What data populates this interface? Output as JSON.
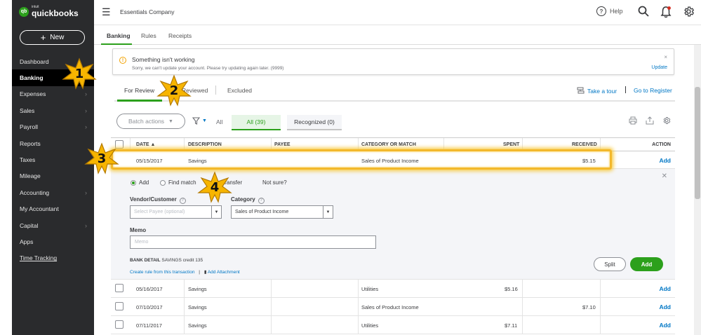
{
  "app": {
    "brand_small": "intuit",
    "brand": "quickbooks",
    "brand_mark": "qb"
  },
  "sidebar": {
    "new_label": "New",
    "items": [
      {
        "label": "Dashboard",
        "chevron": false
      },
      {
        "label": "Banking",
        "chevron": false,
        "active": true
      },
      {
        "label": "Expenses",
        "chevron": true
      },
      {
        "label": "Sales",
        "chevron": true
      },
      {
        "label": "Payroll",
        "chevron": true
      },
      {
        "label": "Reports",
        "chevron": false
      },
      {
        "label": "Taxes",
        "chevron": false
      },
      {
        "label": "Mileage",
        "chevron": false
      },
      {
        "label": "Accounting",
        "chevron": true
      },
      {
        "label": "My Accountant",
        "chevron": false
      },
      {
        "label": "Capital",
        "chevron": true
      },
      {
        "label": "Apps",
        "chevron": false
      },
      {
        "label": "Time Tracking",
        "chevron": false
      }
    ]
  },
  "topbar": {
    "company": "Essentials Company",
    "help": "Help"
  },
  "subtabs": [
    "Banking",
    "Rules",
    "Receipts"
  ],
  "alert": {
    "title": "Something isn't working",
    "message": "Sorry, we can't update your account. Please try updating again later. (9999)",
    "close": "×",
    "update": "Update"
  },
  "review_tabs": {
    "for_review": "For Review",
    "reviewed": "Reviewed",
    "excluded": "Excluded",
    "take_tour": "Take a tour",
    "go_to_register": "Go to Register"
  },
  "toolbar": {
    "batch_actions": "Batch actions",
    "all": "All",
    "all_count": "All (39)",
    "recognized": "Recognized (0)"
  },
  "table": {
    "headers": {
      "date": "DATE ▲",
      "description": "DESCRIPTION",
      "payee": "PAYEE",
      "category": "CATEGORY OR MATCH",
      "spent": "SPENT",
      "received": "RECEIVED",
      "action": "ACTION"
    },
    "highlighted_row": {
      "date": "05/15/2017",
      "description": "Savings",
      "category": "Sales of Product Income",
      "spent": "",
      "received": "$5.15",
      "action": "Add"
    },
    "rows": [
      {
        "date": "05/16/2017",
        "description": "Savings",
        "category": "Utilities",
        "spent": "$5.16",
        "received": "",
        "action": "Add"
      },
      {
        "date": "07/10/2017",
        "description": "Savings",
        "category": "Sales of Product Income",
        "spent": "",
        "received": "$7.10",
        "action": "Add"
      },
      {
        "date": "07/11/2017",
        "description": "Savings",
        "category": "Utilities",
        "spent": "$7.11",
        "received": "",
        "action": "Add"
      }
    ]
  },
  "expanded": {
    "radio_add": "Add",
    "radio_find": "Find match",
    "radio_transfer": "transfer",
    "not_sure": "Not sure?",
    "vendor_label": "Vendor/Customer",
    "vendor_placeholder": "Select Payee (optional)",
    "category_label": "Category",
    "category_value": "Sales of Product Income",
    "memo_label": "Memo",
    "memo_placeholder": "Memo",
    "bank_detail_label": "BANK DETAIL",
    "bank_detail_value": "SAVINGS credit 135",
    "create_rule": "Create rule from this transaction",
    "add_attachment": "Add Attachment",
    "split": "Split",
    "add": "Add"
  },
  "callouts": [
    "1",
    "2",
    "3",
    "4"
  ],
  "colors": {
    "sidebar": "#2a2b2d",
    "accent_green": "#2ca01c",
    "link_blue": "#0077c5",
    "callout_star": "#f7b500",
    "highlight": "#f3b82b"
  }
}
